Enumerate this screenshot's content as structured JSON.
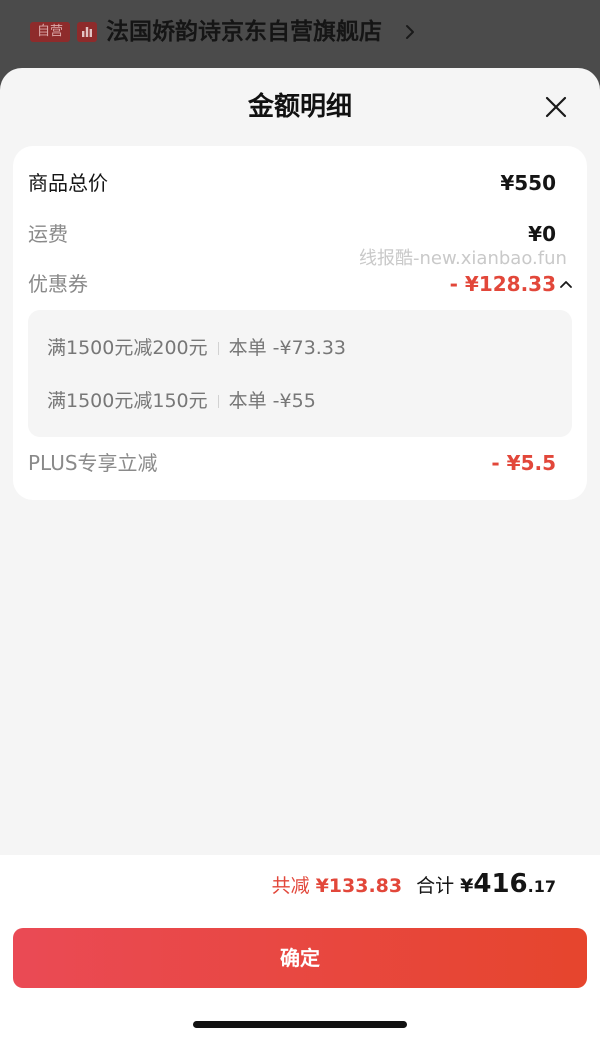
{
  "store_header": {
    "badge": "自营",
    "name": "法国娇韵诗京东自营旗舰店",
    "store_icon": "store-icon",
    "chevron_icon": "chevron-right-icon"
  },
  "sheet": {
    "title": "金额明细",
    "close_icon": "close-icon"
  },
  "details": {
    "goods_total": {
      "label": "商品总价",
      "value": "¥550"
    },
    "shipping": {
      "label": "运费",
      "value": "¥0"
    },
    "coupon": {
      "label": "优惠券",
      "value": "- ¥128.33",
      "expanded": true,
      "toggle_icon": "chevron-up-icon"
    },
    "coupon_items": [
      {
        "rule": "满1500元减200元",
        "amount": "本单 -¥73.33"
      },
      {
        "rule": "满1500元减150元",
        "amount": "本单 -¥55"
      }
    ],
    "plus_discount": {
      "label": "PLUS专享立减",
      "value": "- ¥5.5"
    }
  },
  "watermark": "线报酷-new.xianbao.fun",
  "footer": {
    "discount_label": "共减",
    "discount_value": "¥133.83",
    "total_label": "合计",
    "total_currency": "¥",
    "total_integer": "416",
    "total_decimal": ".17",
    "confirm_label": "确定"
  },
  "colors": {
    "accent_red": "#e2473a",
    "button_gradient_start": "#ea4a55",
    "button_gradient_end": "#e6452d",
    "overlay": "#4b4b4b",
    "sheet_background": "#f5f5f5"
  }
}
